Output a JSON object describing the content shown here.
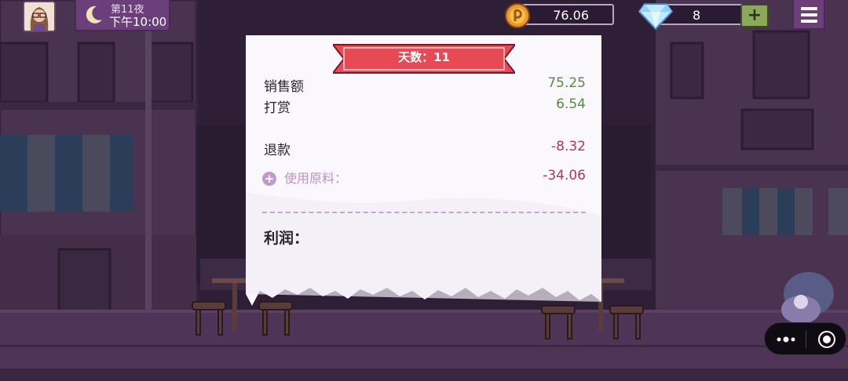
{
  "hud": {
    "night_label": "第11夜",
    "time_label": "下午10:00",
    "coins": "76.06",
    "gems": "8",
    "plus_label": "+"
  },
  "receipt": {
    "day_banner": "天数：11",
    "sales_label": "销售额",
    "sales_value": "75.25",
    "tips_label": "打赏",
    "tips_value": "6.54",
    "refund_label": "退款",
    "refund_value": "-8.32",
    "materials_label": "使用原料：",
    "materials_value": "-34.06",
    "profit_label": "利润："
  },
  "colors": {
    "positive": "#5b8a45",
    "negative": "#b03a4f",
    "banner": "#e84a55",
    "hud_panel": "#6b3f7a"
  },
  "icons": [
    "avatar",
    "moon-icon",
    "coin-icon",
    "diamond-icon",
    "menu-icon",
    "expand-icon",
    "more-dots-icon",
    "record-icon"
  ]
}
